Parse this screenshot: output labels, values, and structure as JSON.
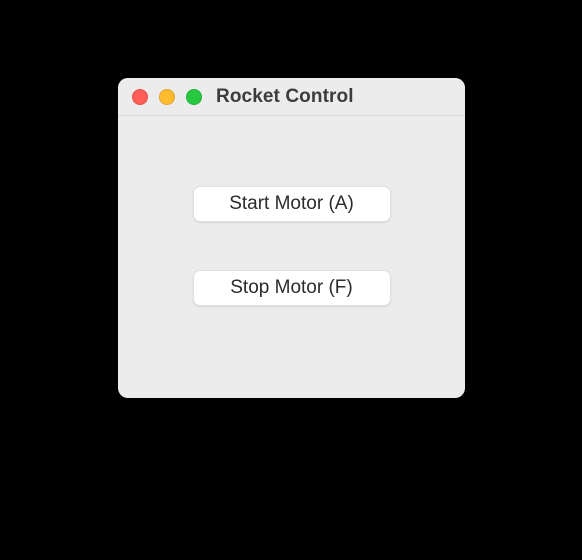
{
  "window": {
    "title": "Rocket Control"
  },
  "buttons": {
    "start": "Start Motor (A)",
    "stop": "Stop Motor (F)"
  }
}
